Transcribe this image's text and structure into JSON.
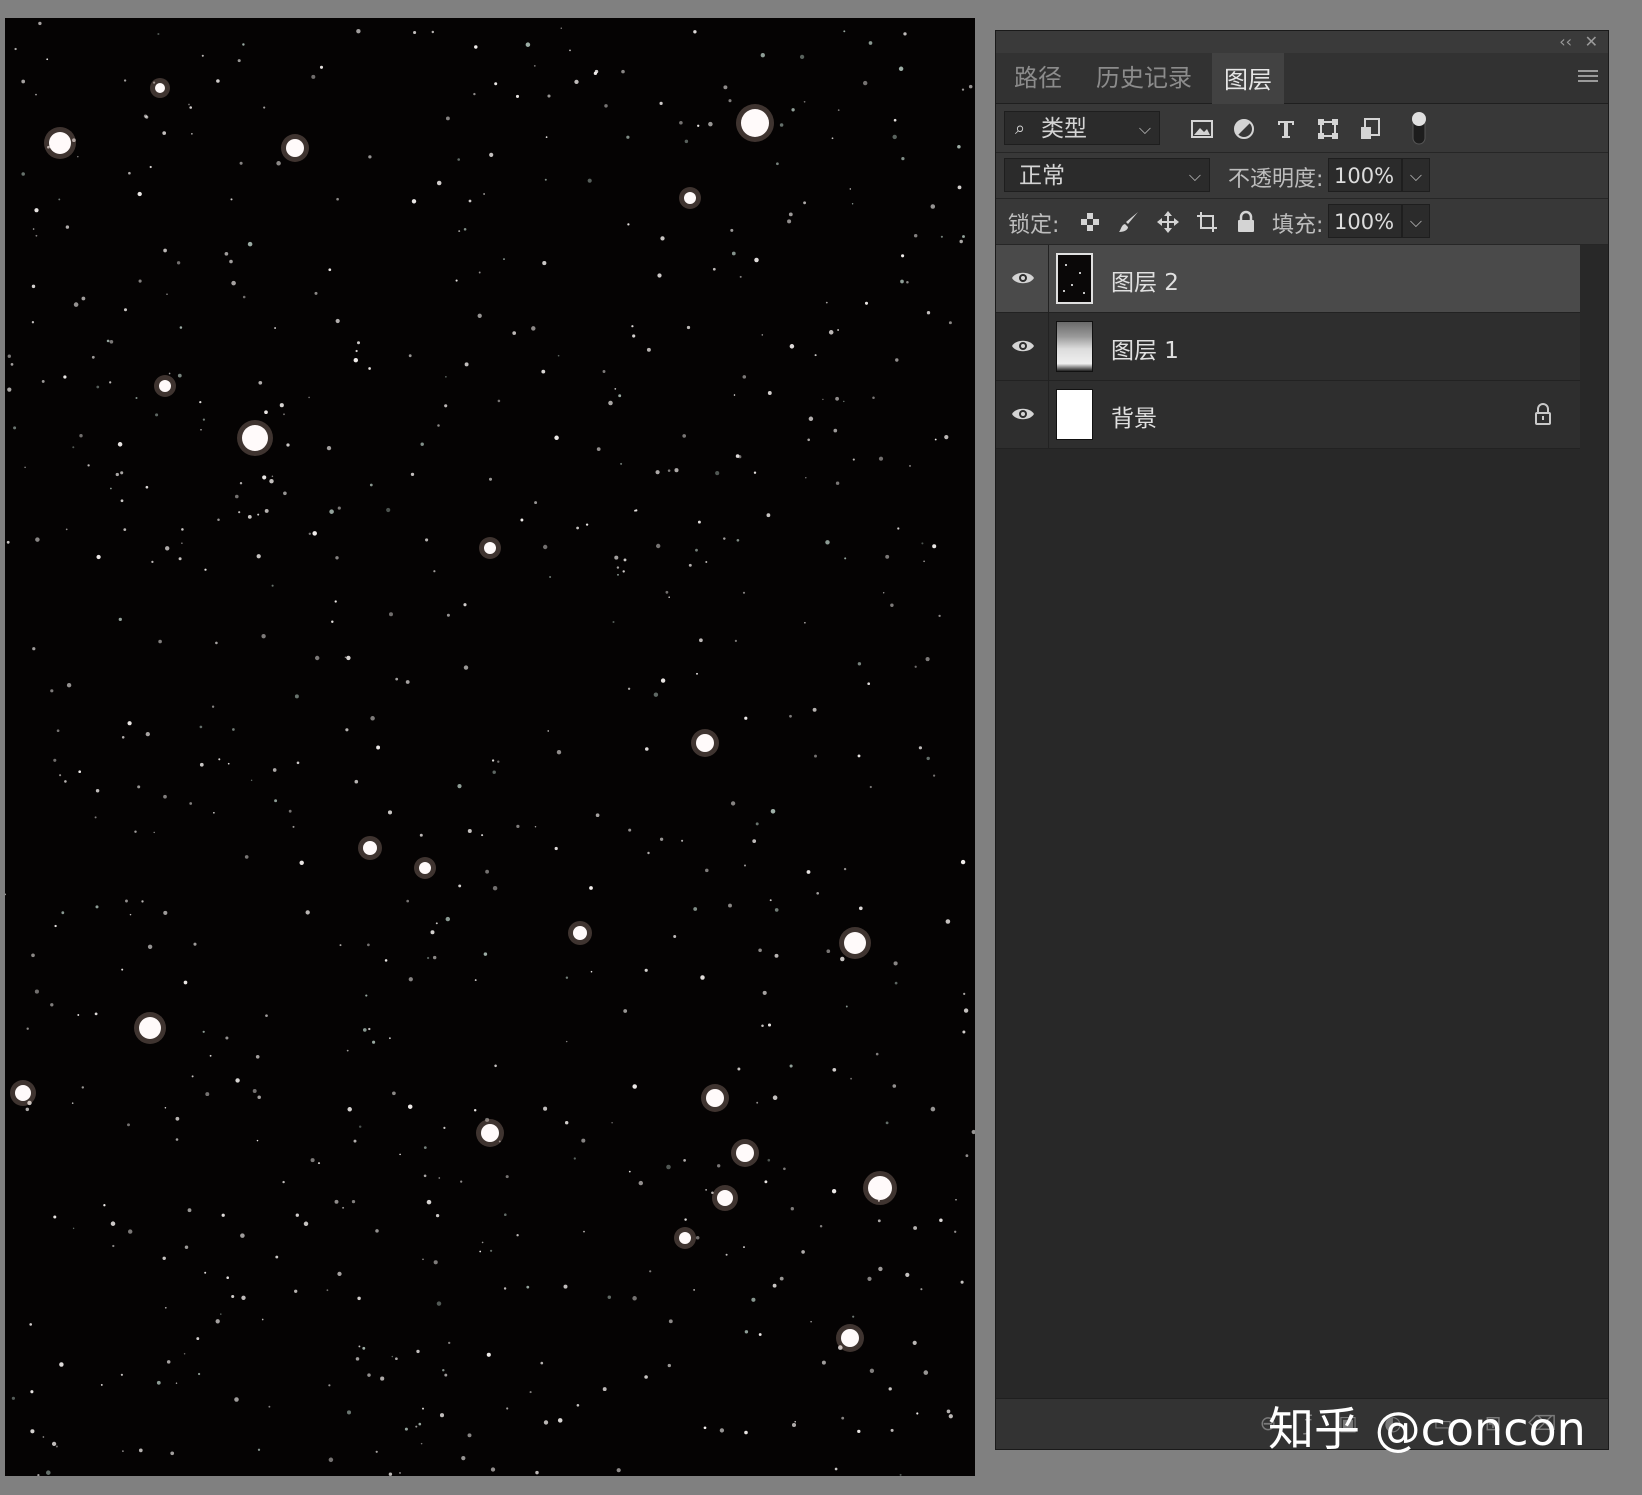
{
  "panel": {
    "tabs": [
      {
        "label": "路径",
        "active": false
      },
      {
        "label": "历史记录",
        "active": false
      },
      {
        "label": "图层",
        "active": true
      }
    ],
    "collapse_icon": "double-chevron-left-icon",
    "close_icon": "close-icon",
    "menu_icon": "panel-menu-icon"
  },
  "filter": {
    "kind_label": "类型",
    "icons": [
      "pixel-layer-filter-icon",
      "adjustment-layer-filter-icon",
      "type-layer-filter-icon",
      "shape-layer-filter-icon",
      "smart-object-filter-icon",
      "filter-toggle-icon"
    ]
  },
  "blend": {
    "mode": "正常",
    "opacity_label": "不透明度:",
    "opacity_value": "100%"
  },
  "lock": {
    "label": "锁定:",
    "icons": [
      "lock-transparent-pixels-icon",
      "lock-image-pixels-icon",
      "lock-position-icon",
      "lock-artboard-icon",
      "lock-all-icon"
    ],
    "fill_label": "填充:",
    "fill_value": "100%"
  },
  "layers": [
    {
      "name": "图层 2",
      "visible": true,
      "selected": true,
      "locked": false
    },
    {
      "name": "图层 1",
      "visible": true,
      "selected": false,
      "locked": false
    },
    {
      "name": "背景",
      "visible": true,
      "selected": false,
      "locked": true
    }
  ],
  "bottom_icons": [
    "link-layers-icon",
    "layer-style-icon",
    "add-mask-icon",
    "new-adjustment-icon",
    "new-group-icon",
    "new-layer-icon",
    "delete-layer-icon"
  ],
  "watermark": "知乎 @concon",
  "colors": {
    "canvas_bg": "#050303",
    "panel_bg": "#282828",
    "app_bg": "#808080"
  }
}
